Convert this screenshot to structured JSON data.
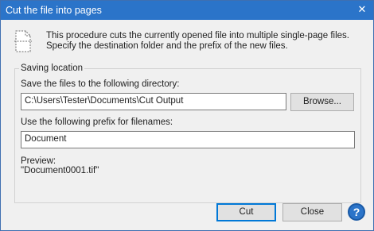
{
  "window": {
    "title": "Cut the file into pages"
  },
  "description": "This procedure cuts the currently opened file into multiple single-page files. Specify the destination folder and the prefix of the new files.",
  "saving": {
    "group_label": "Saving location",
    "directory_label": "Save the files to the following directory:",
    "directory_value": "C:\\Users\\Tester\\Documents\\Cut Output",
    "browse_label": "Browse...",
    "prefix_label": "Use the following prefix for filenames:",
    "prefix_value": "Document",
    "preview_label": "Preview:",
    "preview_value": "\"Document0001.tif\""
  },
  "buttons": {
    "cut": "Cut",
    "close": "Close",
    "help": "?"
  },
  "icons": {
    "close": "close-icon",
    "document": "dashed-document-icon",
    "help": "help-icon"
  },
  "colors": {
    "titlebar": "#2b74c9",
    "accent": "#0078d7"
  }
}
